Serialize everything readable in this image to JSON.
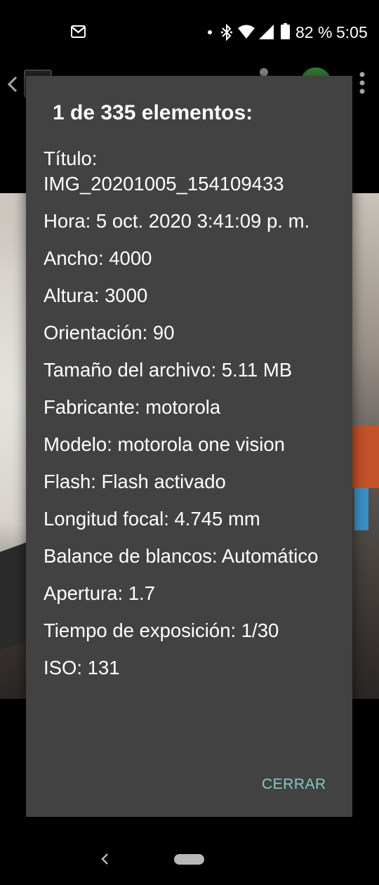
{
  "status_bar": {
    "icons": [
      "gmail-icon",
      "notification-dot-icon",
      "bluetooth-icon",
      "wifi-icon",
      "cell-signal-icon",
      "battery-icon"
    ],
    "battery_percent": "82 %",
    "clock": "5:05"
  },
  "toolbar": {
    "icons": [
      "back-arrow-icon",
      "more-vert-icon"
    ]
  },
  "dialog": {
    "title": "1 de 335 elementos:",
    "rows": [
      "Título: IMG_20201005_154109433",
      "Hora: 5 oct. 2020 3:41:09 p. m.",
      "Ancho: 4000",
      "Altura: 3000",
      "Orientación: 90",
      "Tamaño del archivo: 5.11 MB",
      "Fabricante: motorola",
      "Modelo: motorola one vision",
      "Flash: Flash activado",
      "Longitud focal: 4.745 mm",
      "Balance de blancos: Automático",
      "Apertura: 1.7",
      "Tiempo de exposición: 1/30",
      "ISO: 131"
    ],
    "close_label": "CERRAR"
  },
  "colors": {
    "dialog_bg": "#424242",
    "accent": "#80cbc4"
  }
}
